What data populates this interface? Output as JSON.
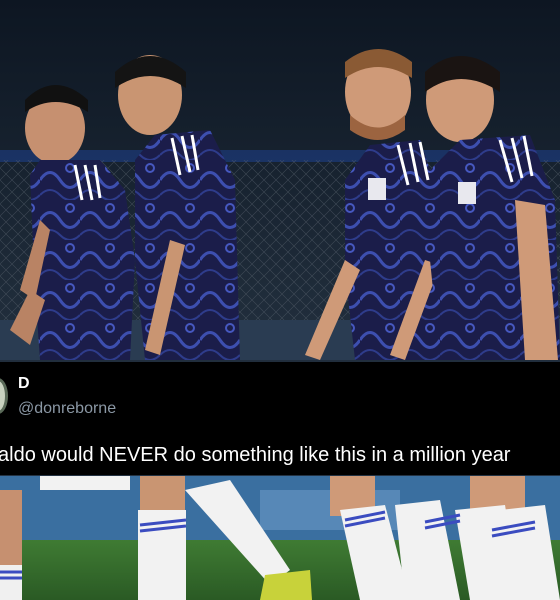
{
  "tweet": {
    "display_name": "D",
    "handle": "@donreborne",
    "text": "aldo would NEVER do something like this in a million year"
  },
  "photo": {
    "description_icon": "football-players-photo",
    "colors": {
      "kit": "#1b1d4a",
      "kit_swirl": "#3a4aa8",
      "stripe": "#ffffff",
      "skin": "#c99572",
      "pitch": "#2f6a2a",
      "stands": "#1d2a38"
    }
  }
}
